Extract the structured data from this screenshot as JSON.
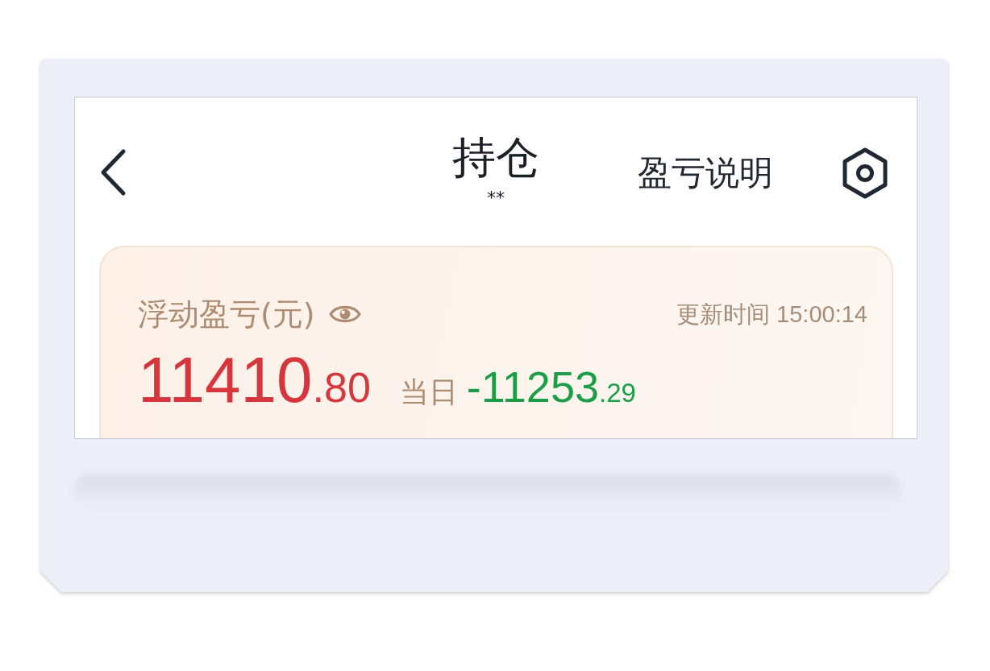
{
  "header": {
    "title": "持仓",
    "account": "**",
    "help_link": "盈亏说明"
  },
  "summary": {
    "label": "浮动盈亏(元)",
    "updated": "更新时间 15:00:14",
    "total": {
      "value": "11410.80",
      "loss": false
    },
    "today": {
      "label": "当日",
      "value": "-11253.29",
      "loss": true
    }
  }
}
